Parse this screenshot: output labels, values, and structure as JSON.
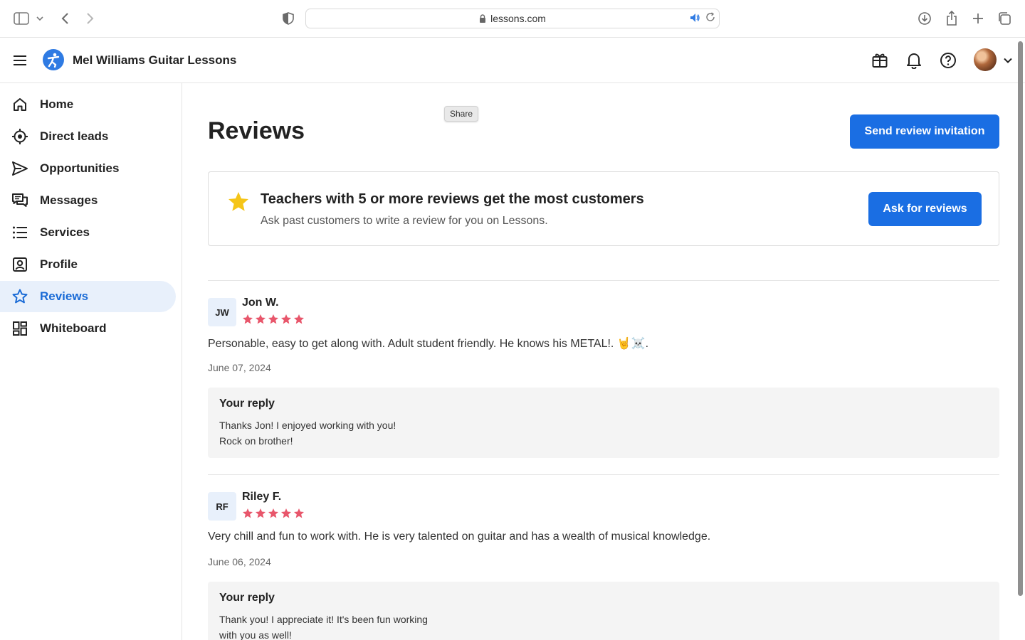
{
  "browser": {
    "url": "lessons.com"
  },
  "header": {
    "app_title": "Mel Williams Guitar Lessons"
  },
  "sidebar": {
    "items": [
      {
        "label": "Home",
        "icon": "home-icon",
        "active": false
      },
      {
        "label": "Direct leads",
        "icon": "target-icon",
        "active": false
      },
      {
        "label": "Opportunities",
        "icon": "send-icon",
        "active": false
      },
      {
        "label": "Messages",
        "icon": "chat-icon",
        "active": false
      },
      {
        "label": "Services",
        "icon": "list-icon",
        "active": false
      },
      {
        "label": "Profile",
        "icon": "profile-icon",
        "active": false
      },
      {
        "label": "Reviews",
        "icon": "star-icon",
        "active": true
      },
      {
        "label": "Whiteboard",
        "icon": "grid-icon",
        "active": false
      }
    ]
  },
  "main": {
    "title": "Reviews",
    "tooltip": "Share",
    "send_invitation_label": "Send review invitation",
    "promo": {
      "title": "Teachers with 5 or more reviews get the most customers",
      "subtitle": "Ask past customers to write a review for you on Lessons.",
      "button_label": "Ask for reviews"
    },
    "reviews": [
      {
        "initials": "JW",
        "name": "Jon W.",
        "rating": 5,
        "text": "Personable, easy to get along with. Adult student friendly. He knows his METAL!. 🤘☠️.",
        "date": "June 07, 2024",
        "reply_title": "Your reply",
        "reply_text": "Thanks Jon! I enjoyed working with you! Rock on brother!"
      },
      {
        "initials": "RF",
        "name": "Riley F.",
        "rating": 5,
        "text": "Very chill and fun to work with. He is very talented on guitar and has a wealth of musical knowledge.",
        "date": "June 06, 2024",
        "reply_title": "Your reply",
        "reply_text": "Thank you! I appreciate it! It's been fun working with you as well!"
      }
    ]
  },
  "colors": {
    "accent": "#1a6ee3",
    "active_nav_bg": "#e8f0fb",
    "star": "#e8566b",
    "promo_star": "#f5c518"
  }
}
